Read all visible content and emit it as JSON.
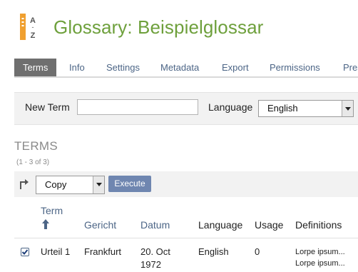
{
  "header": {
    "title": "Glossary: Beispielglossar",
    "logo_icon": "glossary-az-icon"
  },
  "tabs": [
    {
      "label": "Terms",
      "active": true
    },
    {
      "label": "Info"
    },
    {
      "label": "Settings"
    },
    {
      "label": "Metadata"
    },
    {
      "label": "Export"
    },
    {
      "label": "Permissions"
    },
    {
      "label": "Pres"
    }
  ],
  "new_term": {
    "label": "New Term",
    "value": "",
    "language_label": "Language",
    "language_value": "English"
  },
  "terms": {
    "heading": "TERMS",
    "count": "(1 - 3 of 3)",
    "action_value": "Copy",
    "execute_label": "Execute",
    "columns": [
      "Term",
      "Gericht",
      "Datum",
      "Language",
      "Usage",
      "Definitions"
    ],
    "rows": [
      {
        "checked": true,
        "term": "Urteil 1",
        "gericht": "Frankfurt",
        "datum_line1": "20. Oct",
        "datum_line2": "1972",
        "language": "English",
        "usage": "0",
        "def_line1": "Lorpe ipsum...",
        "def_line2": "Lorpe ipsum..."
      }
    ]
  },
  "colors": {
    "title_green": "#6ea03c",
    "link_blue": "#4c6586",
    "tab_active_bg": "#6f6f6f",
    "execute_bg": "#6f86b0"
  }
}
